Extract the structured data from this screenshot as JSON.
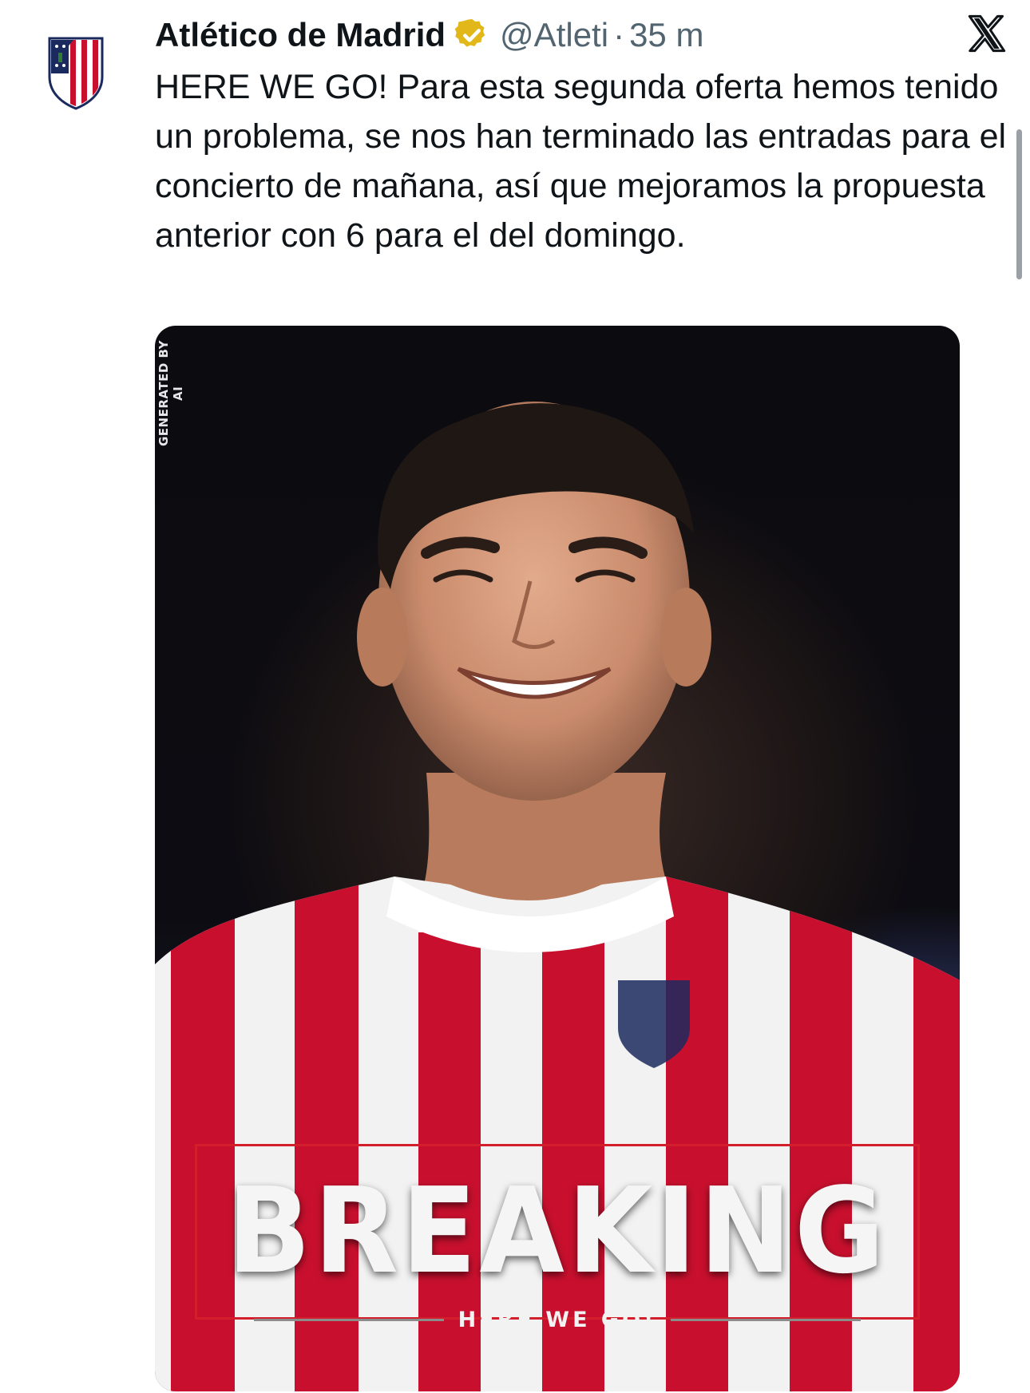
{
  "tweet": {
    "author_name": "Atlético de Madrid",
    "handle": "@Atleti",
    "separator": "·",
    "timestamp": "35 m",
    "text": "HERE WE GO! Para esta segunda oferta hemos tenido un problema, se nos han terminado las entradas para el concierto de mañana, así que mejoramos la propuesta anterior con 6 para el del domingo.",
    "verified_badge_color": "#e2b719",
    "avatar_icon": "atletico-crest-icon",
    "platform_icon": "x-logo-icon"
  },
  "media": {
    "watermark": "GENERATED BY AI",
    "headline": "BREAKING",
    "subheadline": "HERE WE GO!",
    "accent_color": "#d21f2b",
    "kit_colors": [
      "#c8102e",
      "#ffffff"
    ]
  }
}
